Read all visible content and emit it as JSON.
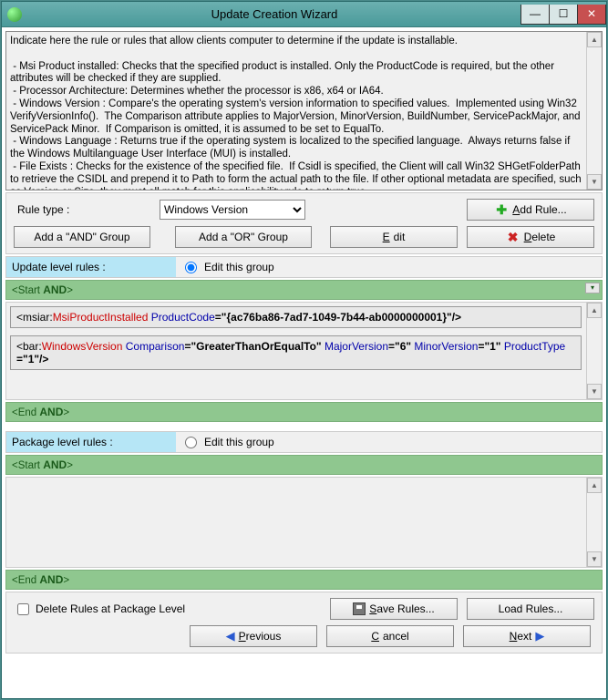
{
  "window": {
    "title": "Update Creation Wizard"
  },
  "info": {
    "text": "Indicate here the rule or rules that allow clients computer to determine if the update is installable.\n\n - Msi Product installed: Checks that the specified product is installed. Only the ProductCode is required, but the other attributes will be checked if they are supplied.\n - Processor Architecture: Determines whether the processor is x86, x64 or IA64.\n - Windows Version : Compare's the operating system's version information to specified values.  Implemented using Win32 VerifyVersionInfo().  The Comparison attribute applies to MajorVersion, MinorVersion, BuildNumber, ServicePackMajor, and ServicePack Minor.  If Comparison is omitted, it is assumed to be set to EqualTo.\n - Windows Language : Returns true if the operating system is localized to the specified language.  Always returns false if the Windows Multilanguage User Interface (MUI) is installed.\n - File Exists : Checks for the existence of the specified file.  If Csidl is specified, the Client will call Win32 SHGetFolderPath to retrieve the CSIDL and prepend it to Path to form the actual path to the file. If other optional metadata are specified, such as Version or Size, they must all match for this applicability rule to return true."
  },
  "controls": {
    "rule_type_label": "Rule type :",
    "rule_type_value": "Windows Version",
    "add_rule": "Add Rule...",
    "add_and": "Add a \"AND\" Group",
    "add_or": "Add a \"OR\" Group",
    "edit": "Edit",
    "delete": "Delete"
  },
  "sections": {
    "update_rules_label": "Update level rules :",
    "package_rules_label": "Package level rules :",
    "edit_this_group": "Edit this group",
    "start_and": "<Start AND>",
    "end_and": "<End AND>"
  },
  "rules": {
    "r1": {
      "prefix": "<msiar:",
      "tag": "MsiProductInstalled",
      "attr1": " ProductCode",
      "val1": "=\"{ac76ba86-7ad7-1049-7b44-ab0000000001}\"/>"
    },
    "r2": {
      "prefix": "<bar:",
      "tag": "WindowsVersion",
      "attr1": " Comparison",
      "val1": "=\"GreaterThanOrEqualTo\"",
      "attr2": " MajorVersion",
      "val2": "=\"6\"",
      "attr3": " MinorVersion",
      "val3": "=\"1\"",
      "attr4": " ProductType",
      "val4": "=\"1\"/>"
    }
  },
  "footer": {
    "delete_pkg_level": "Delete Rules at Package Level",
    "save_rules": "Save Rules...",
    "load_rules": "Load Rules...",
    "previous": "Previous",
    "cancel": "Cancel",
    "next": "Next"
  }
}
